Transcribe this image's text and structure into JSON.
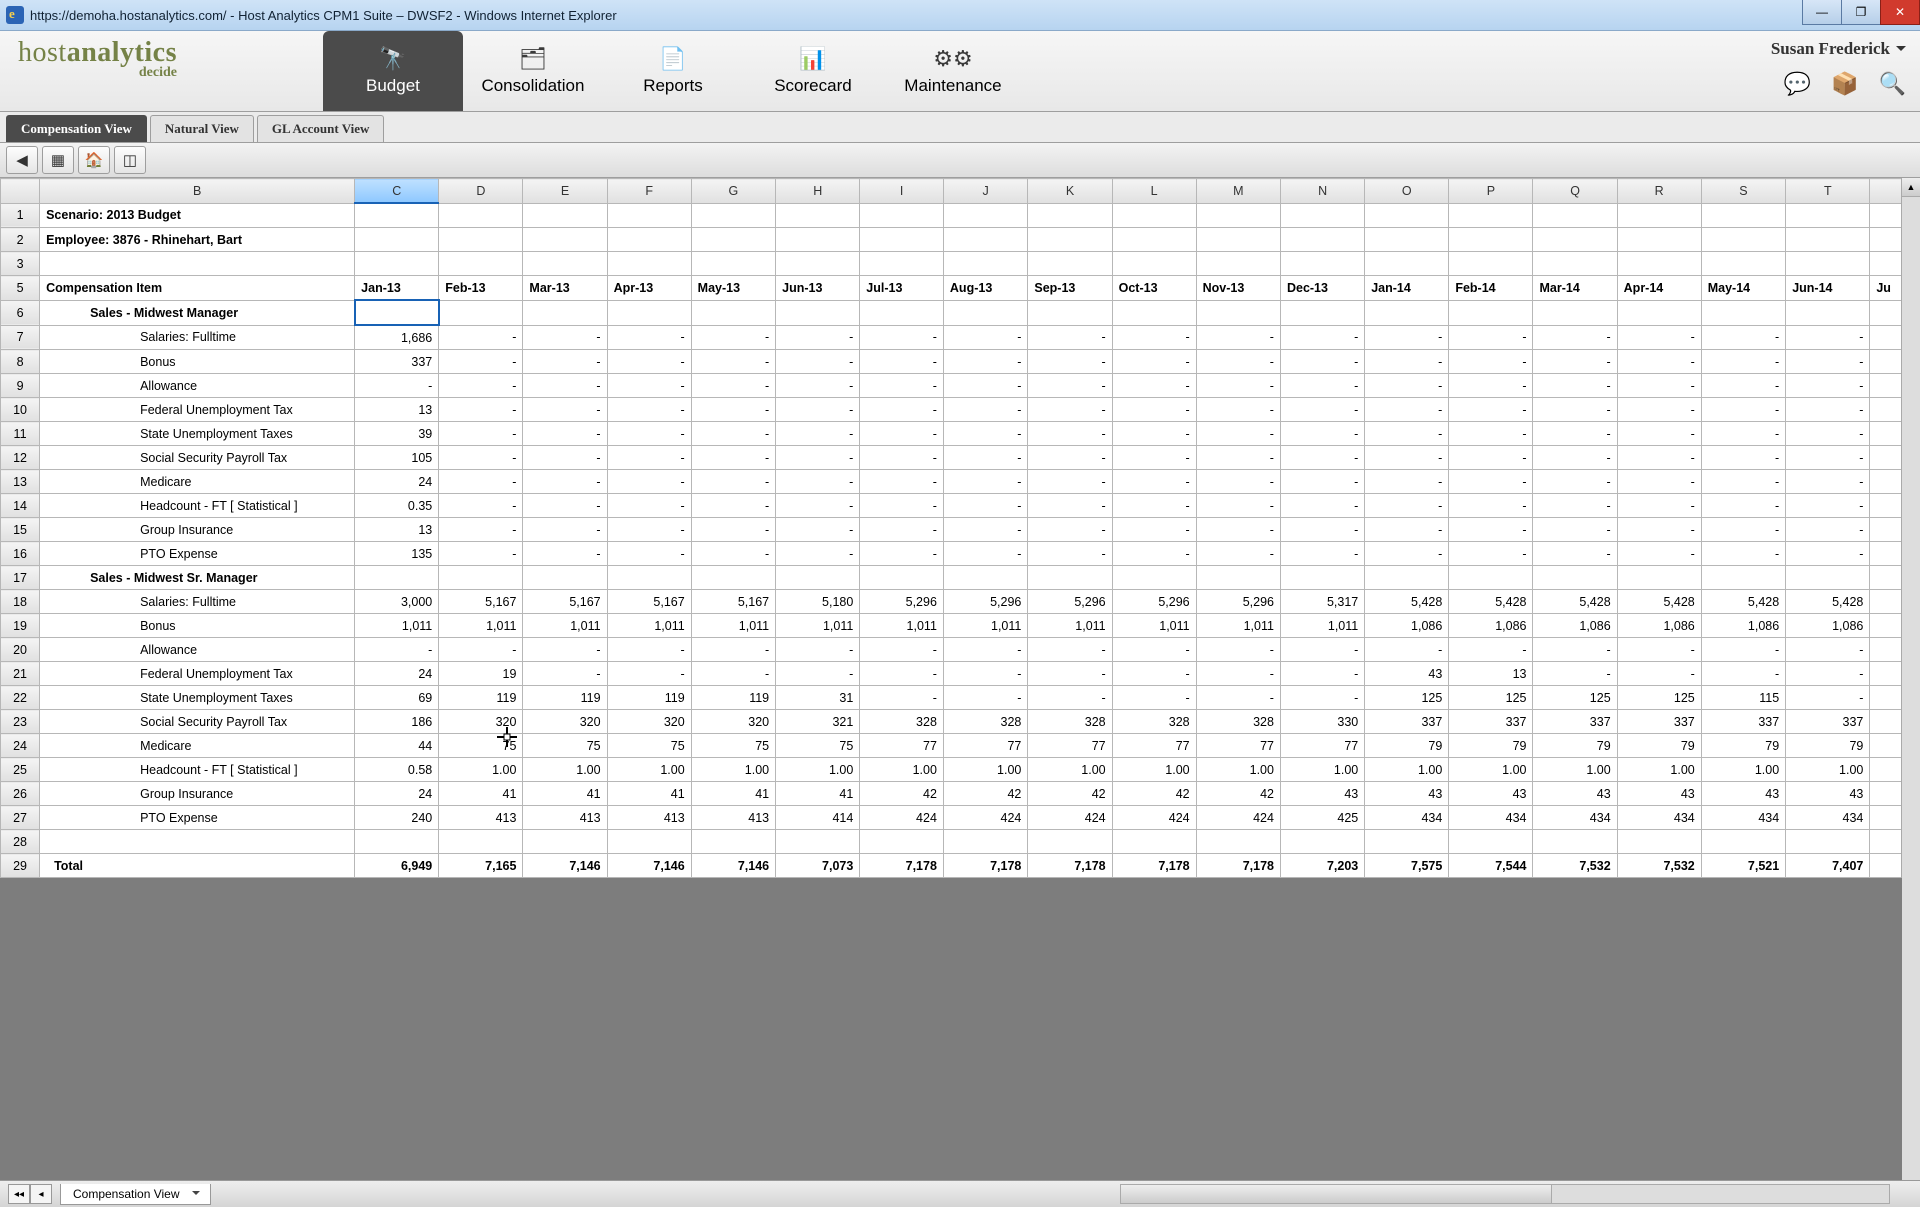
{
  "window": {
    "url": "https://demoha.hostanalytics.com/",
    "title": "Host Analytics CPM1 Suite – DWSF2 - Windows Internet Explorer"
  },
  "brand": {
    "line1a": "host",
    "line1b": "analytics",
    "line2": "decide"
  },
  "nav": [
    {
      "label": "Budget",
      "icon": "🔭",
      "active": true
    },
    {
      "label": "Consolidation",
      "icon": "🗂"
    },
    {
      "label": "Reports",
      "icon": "📄"
    },
    {
      "label": "Scorecard",
      "icon": "📊"
    },
    {
      "label": "Maintenance",
      "icon": "⚙⚙"
    }
  ],
  "user": {
    "name": "Susan Frederick"
  },
  "user_icons": [
    "💬",
    "📦",
    "🔍"
  ],
  "view_tabs": [
    {
      "label": "Compensation View",
      "active": true
    },
    {
      "label": "Natural View"
    },
    {
      "label": "GL Account View"
    }
  ],
  "toolbar_icons": [
    "◀",
    "▦",
    "🏠",
    "◫"
  ],
  "sheet_tab": {
    "name": "Compensation View"
  },
  "columns": [
    "",
    "B",
    "C",
    "D",
    "E",
    "F",
    "G",
    "H",
    "I",
    "J",
    "K",
    "L",
    "M",
    "N",
    "O",
    "P",
    "Q",
    "R",
    "S",
    "T"
  ],
  "selected_col_index": 2,
  "months": [
    "Jan-13",
    "Feb-13",
    "Mar-13",
    "Apr-13",
    "May-13",
    "Jun-13",
    "Jul-13",
    "Aug-13",
    "Sep-13",
    "Oct-13",
    "Nov-13",
    "Dec-13",
    "Jan-14",
    "Feb-14",
    "Mar-14",
    "Apr-14",
    "May-14",
    "Jun-14"
  ],
  "header_rows": {
    "r1": "Scenario: 2013 Budget",
    "r2": "Employee: 3876 - Rhinehart, Bart",
    "r5": "Compensation Item"
  },
  "groups": [
    {
      "row": 6,
      "label": "Sales - Midwest Manager"
    },
    {
      "row": 17,
      "label": "Sales - Midwest Sr. Manager"
    }
  ],
  "items": [
    {
      "row": 7,
      "label": "Salaries: Fulltime",
      "vals": [
        "1,686",
        "-",
        "-",
        "-",
        "-",
        "-",
        "-",
        "-",
        "-",
        "-",
        "-",
        "-",
        "-",
        "-",
        "-",
        "-",
        "-",
        "-"
      ]
    },
    {
      "row": 8,
      "label": "Bonus",
      "vals": [
        "337",
        "-",
        "-",
        "-",
        "-",
        "-",
        "-",
        "-",
        "-",
        "-",
        "-",
        "-",
        "-",
        "-",
        "-",
        "-",
        "-",
        "-"
      ]
    },
    {
      "row": 9,
      "label": "Allowance",
      "vals": [
        "-",
        "-",
        "-",
        "-",
        "-",
        "-",
        "-",
        "-",
        "-",
        "-",
        "-",
        "-",
        "-",
        "-",
        "-",
        "-",
        "-",
        "-"
      ]
    },
    {
      "row": 10,
      "label": "Federal Unemployment Tax",
      "vals": [
        "13",
        "-",
        "-",
        "-",
        "-",
        "-",
        "-",
        "-",
        "-",
        "-",
        "-",
        "-",
        "-",
        "-",
        "-",
        "-",
        "-",
        "-"
      ]
    },
    {
      "row": 11,
      "label": "State Unemployment Taxes",
      "vals": [
        "39",
        "-",
        "-",
        "-",
        "-",
        "-",
        "-",
        "-",
        "-",
        "-",
        "-",
        "-",
        "-",
        "-",
        "-",
        "-",
        "-",
        "-"
      ]
    },
    {
      "row": 12,
      "label": "Social Security Payroll Tax",
      "vals": [
        "105",
        "-",
        "-",
        "-",
        "-",
        "-",
        "-",
        "-",
        "-",
        "-",
        "-",
        "-",
        "-",
        "-",
        "-",
        "-",
        "-",
        "-"
      ]
    },
    {
      "row": 13,
      "label": "Medicare",
      "vals": [
        "24",
        "-",
        "-",
        "-",
        "-",
        "-",
        "-",
        "-",
        "-",
        "-",
        "-",
        "-",
        "-",
        "-",
        "-",
        "-",
        "-",
        "-"
      ]
    },
    {
      "row": 14,
      "label": "Headcount - FT  [ Statistical ]",
      "vals": [
        "0.35",
        "-",
        "-",
        "-",
        "-",
        "-",
        "-",
        "-",
        "-",
        "-",
        "-",
        "-",
        "-",
        "-",
        "-",
        "-",
        "-",
        "-"
      ]
    },
    {
      "row": 15,
      "label": "Group Insurance",
      "vals": [
        "13",
        "-",
        "-",
        "-",
        "-",
        "-",
        "-",
        "-",
        "-",
        "-",
        "-",
        "-",
        "-",
        "-",
        "-",
        "-",
        "-",
        "-"
      ]
    },
    {
      "row": 16,
      "label": "PTO Expense",
      "vals": [
        "135",
        "-",
        "-",
        "-",
        "-",
        "-",
        "-",
        "-",
        "-",
        "-",
        "-",
        "-",
        "-",
        "-",
        "-",
        "-",
        "-",
        "-"
      ]
    },
    {
      "row": 18,
      "label": "Salaries: Fulltime",
      "vals": [
        "3,000",
        "5,167",
        "5,167",
        "5,167",
        "5,167",
        "5,180",
        "5,296",
        "5,296",
        "5,296",
        "5,296",
        "5,296",
        "5,317",
        "5,428",
        "5,428",
        "5,428",
        "5,428",
        "5,428",
        "5,428"
      ]
    },
    {
      "row": 19,
      "label": "Bonus",
      "vals": [
        "1,011",
        "1,011",
        "1,011",
        "1,011",
        "1,011",
        "1,011",
        "1,011",
        "1,011",
        "1,011",
        "1,011",
        "1,011",
        "1,011",
        "1,086",
        "1,086",
        "1,086",
        "1,086",
        "1,086",
        "1,086"
      ]
    },
    {
      "row": 20,
      "label": "Allowance",
      "vals": [
        "-",
        "-",
        "-",
        "-",
        "-",
        "-",
        "-",
        "-",
        "-",
        "-",
        "-",
        "-",
        "-",
        "-",
        "-",
        "-",
        "-",
        "-"
      ]
    },
    {
      "row": 21,
      "label": "Federal Unemployment Tax",
      "vals": [
        "24",
        "19",
        "-",
        "-",
        "-",
        "-",
        "-",
        "-",
        "-",
        "-",
        "-",
        "-",
        "43",
        "13",
        "-",
        "-",
        "-",
        "-"
      ]
    },
    {
      "row": 22,
      "label": "State Unemployment Taxes",
      "vals": [
        "69",
        "119",
        "119",
        "119",
        "119",
        "31",
        "-",
        "-",
        "-",
        "-",
        "-",
        "-",
        "125",
        "125",
        "125",
        "125",
        "115",
        "-"
      ]
    },
    {
      "row": 23,
      "label": "Social Security Payroll Tax",
      "vals": [
        "186",
        "320",
        "320",
        "320",
        "320",
        "321",
        "328",
        "328",
        "328",
        "328",
        "328",
        "330",
        "337",
        "337",
        "337",
        "337",
        "337",
        "337"
      ]
    },
    {
      "row": 24,
      "label": "Medicare",
      "vals": [
        "44",
        "75",
        "75",
        "75",
        "75",
        "75",
        "77",
        "77",
        "77",
        "77",
        "77",
        "77",
        "79",
        "79",
        "79",
        "79",
        "79",
        "79"
      ]
    },
    {
      "row": 25,
      "label": "Headcount - FT  [ Statistical ]",
      "vals": [
        "0.58",
        "1.00",
        "1.00",
        "1.00",
        "1.00",
        "1.00",
        "1.00",
        "1.00",
        "1.00",
        "1.00",
        "1.00",
        "1.00",
        "1.00",
        "1.00",
        "1.00",
        "1.00",
        "1.00",
        "1.00"
      ]
    },
    {
      "row": 26,
      "label": "Group Insurance",
      "vals": [
        "24",
        "41",
        "41",
        "41",
        "41",
        "41",
        "42",
        "42",
        "42",
        "42",
        "42",
        "43",
        "43",
        "43",
        "43",
        "43",
        "43",
        "43"
      ]
    },
    {
      "row": 27,
      "label": "PTO Expense",
      "vals": [
        "240",
        "413",
        "413",
        "413",
        "413",
        "414",
        "424",
        "424",
        "424",
        "424",
        "424",
        "425",
        "434",
        "434",
        "434",
        "434",
        "434",
        "434"
      ]
    }
  ],
  "total": {
    "row": 29,
    "label": "Total",
    "vals": [
      "6,949",
      "7,165",
      "7,146",
      "7,146",
      "7,146",
      "7,073",
      "7,178",
      "7,178",
      "7,178",
      "7,178",
      "7,178",
      "7,203",
      "7,575",
      "7,544",
      "7,532",
      "7,532",
      "7,521",
      "7,407"
    ]
  },
  "blank_rows": [
    3,
    28
  ],
  "row_numbers": [
    1,
    2,
    3,
    5,
    6,
    7,
    8,
    9,
    10,
    11,
    12,
    13,
    14,
    15,
    16,
    17,
    18,
    19,
    20,
    21,
    22,
    23,
    24,
    25,
    26,
    27,
    28,
    29
  ],
  "extra_right_col": "Ju"
}
